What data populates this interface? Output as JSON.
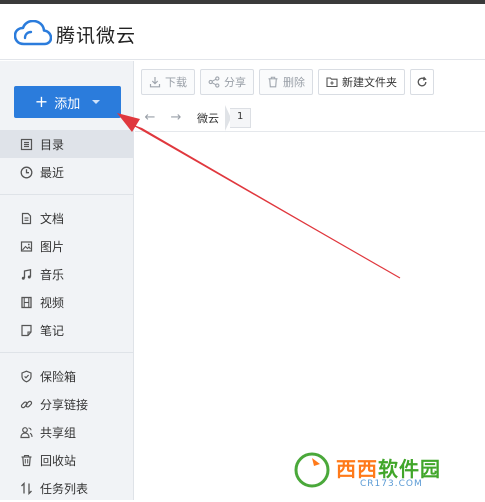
{
  "app": {
    "title": "腾讯微云"
  },
  "sidebar": {
    "add_button": {
      "label": "添加"
    },
    "group1": [
      {
        "label": "目录",
        "icon": "list-icon",
        "active": true
      },
      {
        "label": "最近",
        "icon": "clock-icon"
      }
    ],
    "group2": [
      {
        "label": "文档",
        "icon": "document-icon"
      },
      {
        "label": "图片",
        "icon": "image-icon"
      },
      {
        "label": "音乐",
        "icon": "music-icon"
      },
      {
        "label": "视频",
        "icon": "video-icon"
      },
      {
        "label": "笔记",
        "icon": "note-icon"
      }
    ],
    "group3": [
      {
        "label": "保险箱",
        "icon": "shield-icon"
      },
      {
        "label": "分享链接",
        "icon": "link-icon"
      },
      {
        "label": "共享组",
        "icon": "group-icon"
      },
      {
        "label": "回收站",
        "icon": "trash-icon"
      },
      {
        "label": "任务列表",
        "icon": "transfer-icon"
      }
    ]
  },
  "toolbar": {
    "download": "下载",
    "share": "分享",
    "delete": "删除",
    "new_folder": "新建文件夹"
  },
  "breadcrumb": {
    "root": "微云",
    "page": "1"
  },
  "watermark": {
    "text_orange": "西西",
    "text_green": "软件园",
    "url": "CR173.COM"
  },
  "colors": {
    "accent": "#2b7cdc",
    "annotation_arrow": "#e0383e"
  }
}
